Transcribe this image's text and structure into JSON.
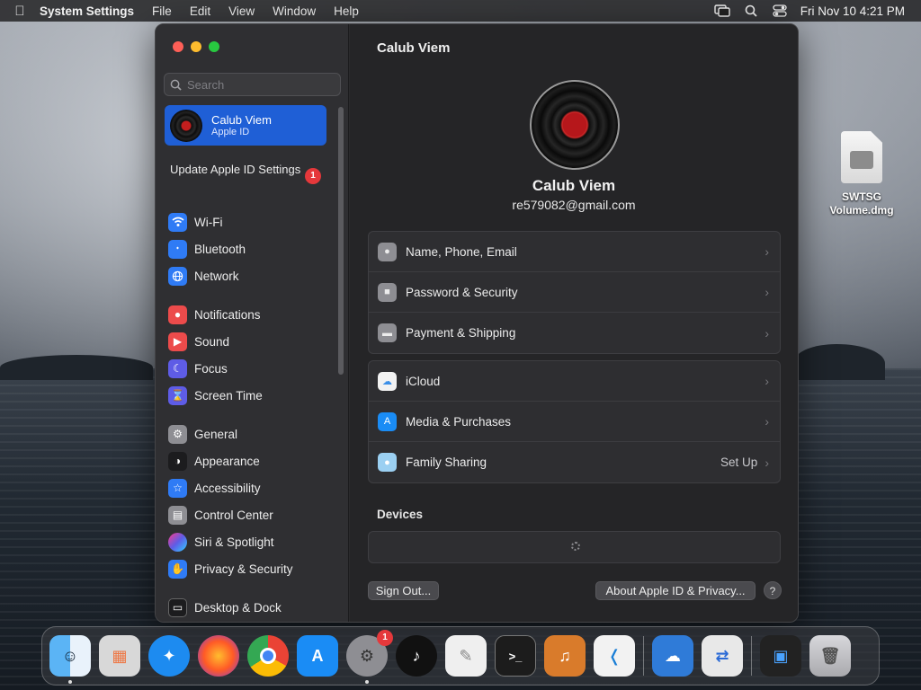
{
  "menubar": {
    "app_name": "System Settings",
    "menus": [
      "File",
      "Edit",
      "View",
      "Window",
      "Help"
    ],
    "clock": "Fri Nov 10  4:21 PM"
  },
  "desktop": {
    "item_label": "SWTSG Volume.dmg"
  },
  "sidebar": {
    "search_placeholder": "Search",
    "profile": {
      "name": "Calub Viem",
      "subtitle": "Apple ID"
    },
    "update": {
      "label": "Update Apple ID Settings",
      "badge": "1"
    },
    "groups": [
      [
        {
          "label": "Wi-Fi",
          "icon": "wifi-icon",
          "color": "#2f7bf5"
        },
        {
          "label": "Bluetooth",
          "icon": "bluetooth-icon",
          "color": "#2f7bf5"
        },
        {
          "label": "Network",
          "icon": "globe-icon",
          "color": "#2f7bf5"
        }
      ],
      [
        {
          "label": "Notifications",
          "icon": "bell-icon",
          "color": "#ec4b4b"
        },
        {
          "label": "Sound",
          "icon": "speaker-icon",
          "color": "#ec4b4b"
        },
        {
          "label": "Focus",
          "icon": "moon-icon",
          "color": "#5e5ce6"
        },
        {
          "label": "Screen Time",
          "icon": "hourglass-icon",
          "color": "#5e5ce6"
        }
      ],
      [
        {
          "label": "General",
          "icon": "gear-icon",
          "color": "#8e8e93"
        },
        {
          "label": "Appearance",
          "icon": "appearance-icon",
          "color": "#1c1c1e"
        },
        {
          "label": "Accessibility",
          "icon": "accessibility-icon",
          "color": "#2f7bf5"
        },
        {
          "label": "Control Center",
          "icon": "control-center-icon",
          "color": "#8e8e93"
        },
        {
          "label": "Siri & Spotlight",
          "icon": "siri-icon",
          "color": "#a24ddb"
        },
        {
          "label": "Privacy & Security",
          "icon": "hand-icon",
          "color": "#2f7bf5"
        }
      ],
      [
        {
          "label": "Desktop & Dock",
          "icon": "dock-icon",
          "color": "#1c1c1e"
        }
      ]
    ]
  },
  "main": {
    "title": "Calub Viem",
    "user_name": "Calub Viem",
    "user_email": "re579082@gmail.com",
    "group1": [
      {
        "label": "Name, Phone, Email",
        "value": "",
        "icon": "contact-icon"
      },
      {
        "label": "Password & Security",
        "value": "",
        "icon": "lock-icon"
      },
      {
        "label": "Payment & Shipping",
        "value": "",
        "icon": "card-icon"
      }
    ],
    "group2": [
      {
        "label": "iCloud",
        "value": "",
        "icon": "icloud-icon"
      },
      {
        "label": "Media & Purchases",
        "value": "",
        "icon": "app-store-icon"
      },
      {
        "label": "Family Sharing",
        "value": "Set Up",
        "icon": "family-icon"
      }
    ],
    "devices_heading": "Devices",
    "sign_out": "Sign Out...",
    "about": "About Apple ID & Privacy...",
    "help": "?"
  },
  "dock": {
    "apps": [
      {
        "name": "Finder",
        "icon": "finder-icon",
        "color": "#3b8fe8"
      },
      {
        "name": "Launchpad",
        "icon": "launchpad-icon",
        "color": "#d8d8d8"
      },
      {
        "name": "Safari",
        "icon": "safari-icon",
        "color": "#1d8bf0"
      },
      {
        "name": "Firefox",
        "icon": "firefox-icon",
        "color": "#7b3ae0"
      },
      {
        "name": "Chrome",
        "icon": "chrome-icon",
        "color": "#f2f2f2"
      },
      {
        "name": "App Store",
        "icon": "app-store-icon",
        "color": "#1a8cf5"
      },
      {
        "name": "System Settings",
        "icon": "settings-icon",
        "color": "#8e8e93",
        "badge": "1"
      },
      {
        "name": "TikTok",
        "icon": "tiktok-icon",
        "color": "#111111"
      },
      {
        "name": "TextEdit",
        "icon": "textedit-icon",
        "color": "#efefef"
      },
      {
        "name": "Terminal",
        "icon": "terminal-icon",
        "color": "#1c1c1c"
      },
      {
        "name": "GarageBand",
        "icon": "guitar-icon",
        "color": "#d97b2b"
      },
      {
        "name": "VS Code",
        "icon": "vscode-icon",
        "color": "#f2f2f2"
      }
    ],
    "apps2": [
      {
        "name": "Weather",
        "icon": "weather-icon",
        "color": "#2f7bd8"
      },
      {
        "name": "Migration",
        "icon": "migration-icon",
        "color": "#e8e8e8"
      }
    ],
    "apps3": [
      {
        "name": "Screen Recorder",
        "icon": "screen-icon",
        "color": "#222222"
      },
      {
        "name": "Trash",
        "icon": "trash-icon",
        "color": "#b9b9bd"
      }
    ]
  }
}
